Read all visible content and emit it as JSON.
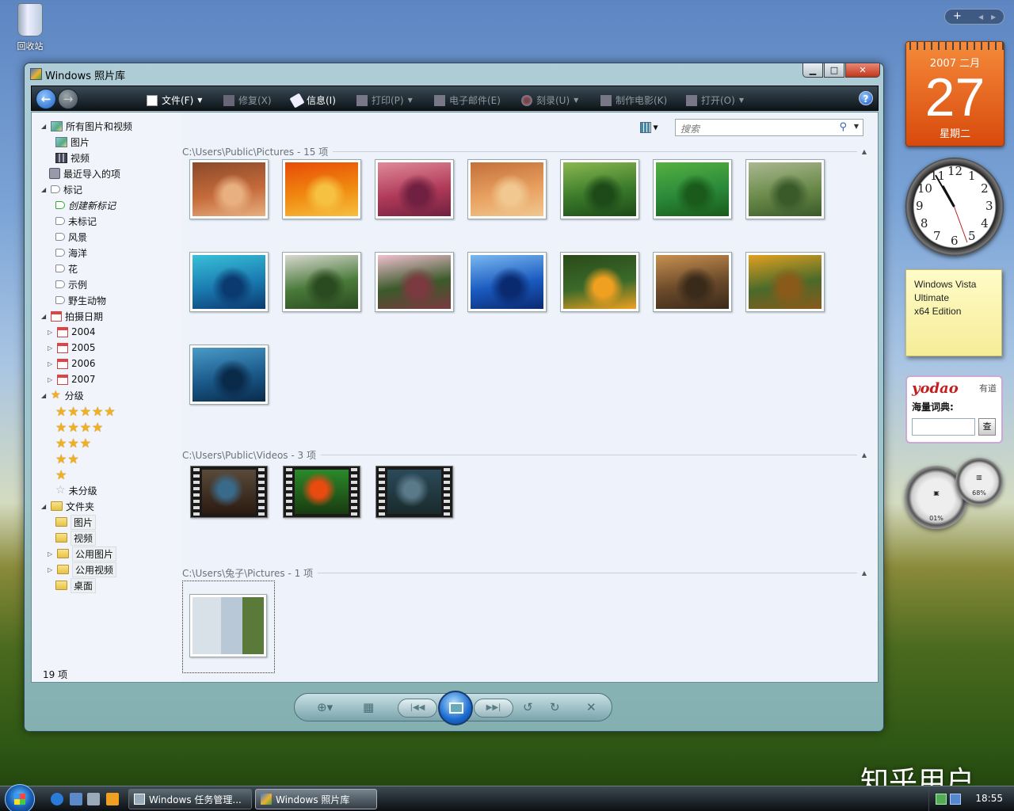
{
  "desktop": {
    "recycle_bin_label": "回收站",
    "watermark": "知乎用户"
  },
  "window": {
    "title": "Windows 照片库"
  },
  "toolbar": {
    "file": "文件(F)",
    "fix": "修复(X)",
    "info": "信息(I)",
    "print": "打印(P)",
    "email": "电子邮件(E)",
    "burn": "刻录(U)",
    "movie": "制作电影(K)",
    "open": "打开(O)",
    "help": "?"
  },
  "search": {
    "placeholder": "搜索"
  },
  "nav": {
    "all": "所有图片和视频",
    "pictures": "图片",
    "videos": "视频",
    "recent": "最近导入的项",
    "tags": "标记",
    "create_tag": "创建新标记",
    "untagged": "未标记",
    "tag_items": [
      "风景",
      "海洋",
      "花",
      "示例",
      "野生动物"
    ],
    "date_taken": "拍摄日期",
    "years": [
      "2004",
      "2005",
      "2006",
      "2007"
    ],
    "rating": "分级",
    "unrated": "未分级",
    "folders": "文件夹",
    "folder_items": [
      "图片",
      "视频",
      "公用图片",
      "公用视频",
      "桌面"
    ],
    "item_count": "19 项"
  },
  "groups": [
    {
      "header": "C:\\Users\\Public\\Pictures - 15 项"
    },
    {
      "header": "C:\\Users\\Public\\Videos - 3 项"
    },
    {
      "header": "C:\\Users\\兔子\\Pictures - 1 项"
    }
  ],
  "thumb_colors": [
    [
      "#c56a3a",
      "#8a4a2a",
      "#e8b080"
    ],
    [
      "#f08a10",
      "#e84a08",
      "#f6c040"
    ],
    [
      "#b03a58",
      "#e08a9a",
      "#702040"
    ],
    [
      "#e8a060",
      "#c4703a",
      "#f0c890"
    ],
    [
      "#3a7a2a",
      "#8ab850",
      "#1d4a18"
    ],
    [
      "#2a8a3a",
      "#55b040",
      "#1a5a1a"
    ],
    [
      "#6a8a4a",
      "#aab890",
      "#3a5a2a"
    ],
    [
      "#1a7ab0",
      "#38c0d8",
      "#0a3a70"
    ],
    [
      "#4a7a3a",
      "#d8d8d0",
      "#2a4a20"
    ],
    [
      "#3a5a2a",
      "#f0c0d0",
      "#7a3a40"
    ],
    [
      "#1a5ac0",
      "#7ab8f0",
      "#0a2a70"
    ],
    [
      "#3a6a2a",
      "#2a4a18",
      "#f0a020"
    ],
    [
      "#6a4a2a",
      "#c89050",
      "#3a2a1a"
    ],
    [
      "#4a6a2a",
      "#e0a020",
      "#8a5a1a"
    ],
    [
      "#1a5a8a",
      "#4a9ac8",
      "#0a2a4a"
    ]
  ],
  "video_colors": [
    [
      "#5a4a3a",
      "#3a6a8a",
      "#2a1a10"
    ],
    [
      "#2a8a2a",
      "#e84a10",
      "#1a3a10"
    ],
    [
      "#2a4a5a",
      "#5a7a8a",
      "#1a2a2a"
    ]
  ],
  "gadgets": {
    "calendar_year_month": "2007 二月",
    "calendar_day": "27",
    "calendar_weekday": "星期二",
    "clock_numbers": [
      "12",
      "1",
      "2",
      "3",
      "4",
      "5",
      "6",
      "7",
      "8",
      "9",
      "10",
      "11"
    ],
    "note_lines": [
      "Windows Vista",
      "Ultimate",
      "x64 Edition"
    ],
    "dictionary_logo": "yodao",
    "dictionary_cn": "有道",
    "dictionary_label": "海量词典:",
    "dictionary_button": "查",
    "cpu_percent": "01%",
    "memory_percent": "68%"
  },
  "taskbar": {
    "tasks": [
      "Windows 任务管理...",
      "Windows 照片库"
    ],
    "time": "18:55"
  }
}
